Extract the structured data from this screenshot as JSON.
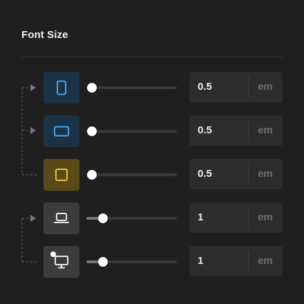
{
  "panel": {
    "title": "Font Size"
  },
  "rows": [
    {
      "device": "tablet-portrait-icon",
      "value": "0.5",
      "unit": "em",
      "level": 0.0,
      "accent": "#4aa3e8"
    },
    {
      "device": "tablet-landscape-icon",
      "value": "0.5",
      "unit": "em",
      "level": 0.0,
      "accent": "#4aa3e8"
    },
    {
      "device": "mobile-square-icon",
      "value": "0.5",
      "unit": "em",
      "level": 0.0,
      "accent": "#f2c230"
    },
    {
      "device": "laptop-icon",
      "value": "1",
      "unit": "em",
      "level": 0.14,
      "accent": "#e8e8e8"
    },
    {
      "device": "desktop-icon",
      "value": "1",
      "unit": "em",
      "level": 0.14,
      "accent": "#e8e8e8"
    }
  ],
  "colors": {
    "background": "#1f1f1f",
    "blue_accent": "#4aa3e8",
    "yellow_accent": "#f2c230",
    "field": "#2c2c2c"
  }
}
